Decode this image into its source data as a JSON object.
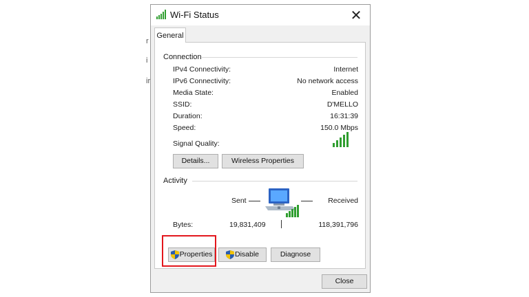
{
  "window": {
    "title": "Wi-Fi Status",
    "close_glyph": "✕"
  },
  "tabs": [
    {
      "label": "General"
    }
  ],
  "connection": {
    "heading": "Connection",
    "rows": [
      {
        "label": "IPv4 Connectivity:",
        "value": "Internet"
      },
      {
        "label": "IPv6 Connectivity:",
        "value": "No network access"
      },
      {
        "label": "Media State:",
        "value": "Enabled"
      },
      {
        "label": "SSID:",
        "value": "D'MELLO"
      },
      {
        "label": "Duration:",
        "value": "16:31:39"
      },
      {
        "label": "Speed:",
        "value": "150.0 Mbps"
      }
    ],
    "signal_label": "Signal Quality:",
    "signal_bars": 5,
    "details_button": "Details...",
    "wireless_button": "Wireless Properties"
  },
  "activity": {
    "heading": "Activity",
    "sent_label": "Sent",
    "received_label": "Received",
    "bytes_label": "Bytes:",
    "bytes_sent": "19,831,409",
    "bytes_received": "118,391,796"
  },
  "actions": {
    "properties": "Properties",
    "disable": "Disable",
    "diagnose": "Diagnose",
    "close": "Close"
  },
  "colors": {
    "signal_green": "#2f9e2f",
    "highlight_red": "#e3161c"
  },
  "background_fragments": [
    "r",
    "i",
    "ir"
  ]
}
